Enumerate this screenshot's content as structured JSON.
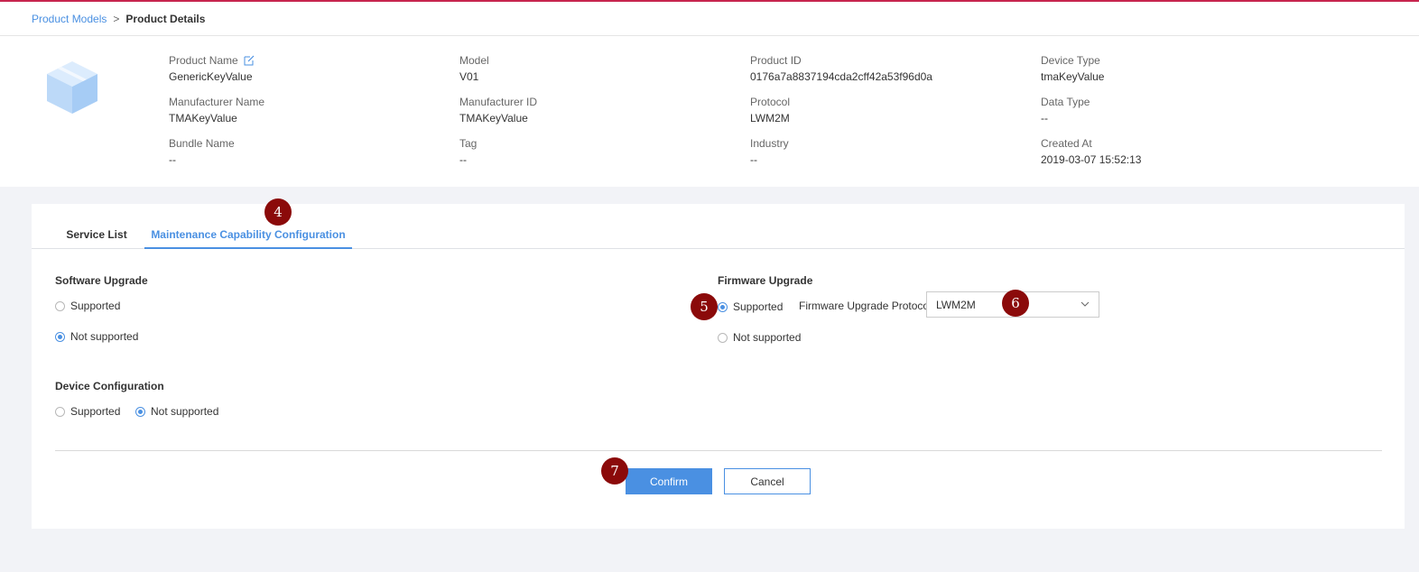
{
  "breadcrumb": {
    "parent": "Product Models",
    "separator": ">",
    "current": "Product Details"
  },
  "info": {
    "product_name": {
      "label": "Product Name",
      "value": "GenericKeyValue"
    },
    "model": {
      "label": "Model",
      "value": "V01"
    },
    "product_id": {
      "label": "Product ID",
      "value": "0176a7a8837194cda2cff42a53f96d0a"
    },
    "device_type": {
      "label": "Device Type",
      "value": "tmaKeyValue"
    },
    "manufacturer_name": {
      "label": "Manufacturer Name",
      "value": "TMAKeyValue"
    },
    "manufacturer_id": {
      "label": "Manufacturer ID",
      "value": "TMAKeyValue"
    },
    "protocol": {
      "label": "Protocol",
      "value": "LWM2M"
    },
    "data_type": {
      "label": "Data Type",
      "value": "--"
    },
    "bundle_name": {
      "label": "Bundle Name",
      "value": "--"
    },
    "tag": {
      "label": "Tag",
      "value": "--"
    },
    "industry": {
      "label": "Industry",
      "value": "--"
    },
    "created_at": {
      "label": "Created At",
      "value": "2019-03-07 15:52:13"
    }
  },
  "tabs": {
    "service_list": "Service List",
    "maintenance": "Maintenance Capability Configuration",
    "active": "maintenance"
  },
  "software_upgrade": {
    "title": "Software Upgrade",
    "supported": "Supported",
    "not_supported": "Not supported",
    "selected": "not_supported"
  },
  "firmware_upgrade": {
    "title": "Firmware Upgrade",
    "supported": "Supported",
    "not_supported": "Not supported",
    "selected": "supported",
    "protocol_label": "Firmware Upgrade Protocol",
    "protocol_value": "LWM2M"
  },
  "device_configuration": {
    "title": "Device Configuration",
    "supported": "Supported",
    "not_supported": "Not supported",
    "selected": "not_supported"
  },
  "actions": {
    "confirm": "Confirm",
    "cancel": "Cancel"
  },
  "markers": {
    "m4": "4",
    "m5": "5",
    "m6": "6",
    "m7": "7"
  },
  "colors": {
    "accent": "#4a90e2",
    "marker": "#8b0a0a",
    "top_line": "#c7254e"
  }
}
